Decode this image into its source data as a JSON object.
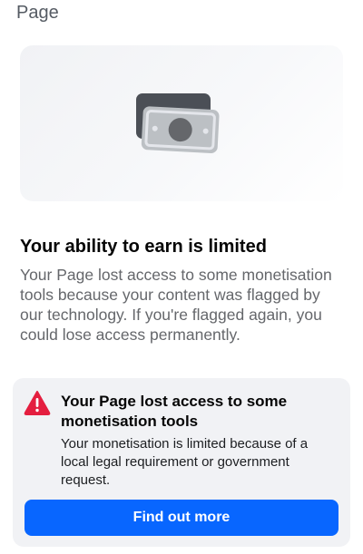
{
  "header": {
    "label": "Page"
  },
  "hero": {
    "icon": "money-icon"
  },
  "headline": "Your ability to earn is limited",
  "description": "Your Page lost access to some monetisation tools because your content was flagged by our technology. If you're flagged again, you could lose access permanently.",
  "alert": {
    "icon": "warning-icon",
    "icon_color": "#e41e3f",
    "title": "Your Page lost access to some monetisation tools",
    "body": "Your monetisation is limited because of a local legal requirement or government request."
  },
  "cta": {
    "label": "Find out more",
    "color": "#0866ff"
  }
}
